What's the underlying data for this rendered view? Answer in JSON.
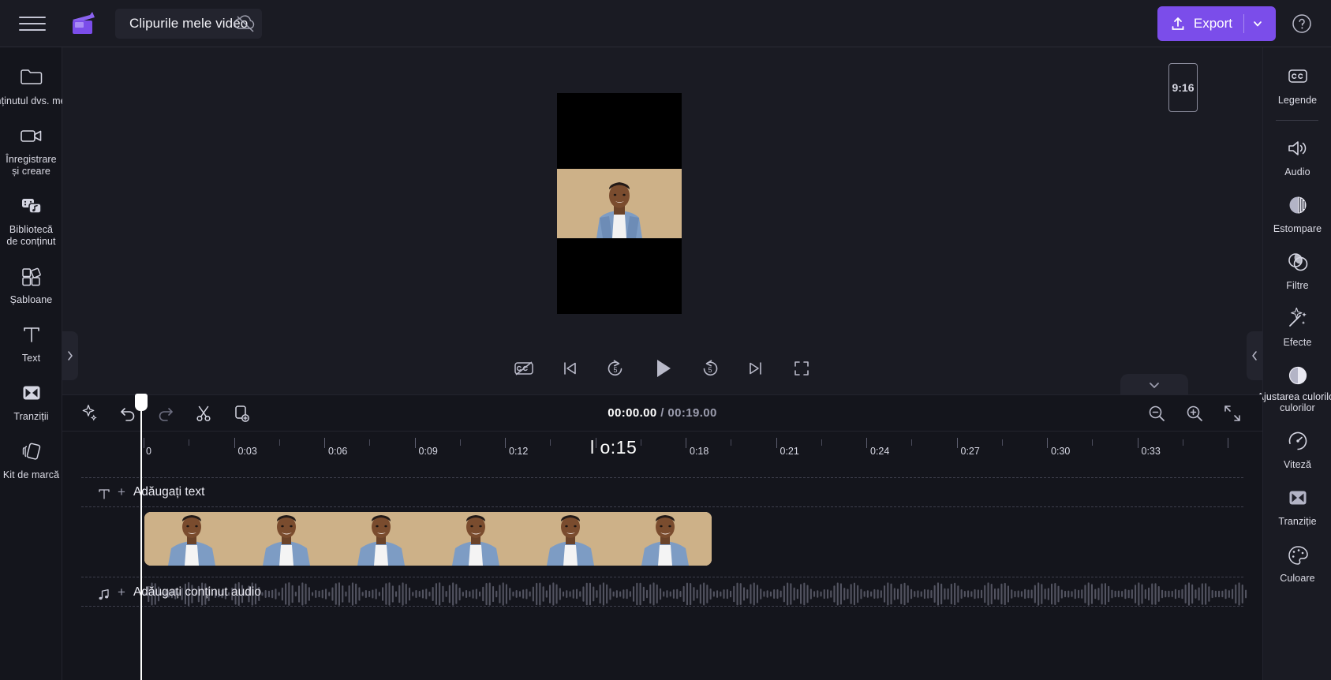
{
  "app": {
    "title": "Clipurile mele video",
    "menu_icon": "hamburger-icon",
    "logo_icon": "clipchamp-logo",
    "cloud_icon": "cloud-offline-icon"
  },
  "topbar": {
    "export_label": "Export",
    "export_color": "#7b4dea",
    "export_icon": "upload-icon",
    "export_chevron": "chevron-down-icon",
    "help_icon": "help-circle-icon"
  },
  "left_rail": {
    "items": [
      {
        "label": "Conținutul dvs. media",
        "icon": "folder-icon",
        "wide": true
      },
      {
        "label": "Înregistrare\ncreare",
        "line1": "Înregistrare",
        "line2": "și creare",
        "icon": "camera-icon"
      },
      {
        "label": "Bibliotecă de conținut",
        "line1": "Bibliotecă",
        "line2": "de conținut",
        "icon": "content-library-icon"
      },
      {
        "label": "Șabloane",
        "line1": "Șabloane",
        "line2": "",
        "icon": "templates-icon"
      },
      {
        "label": "Text",
        "line1": "Text",
        "line2": "",
        "icon": "text-icon"
      },
      {
        "label": "Tranziții",
        "line1": "Tranziții",
        "line2": "",
        "icon": "transitions-icon"
      },
      {
        "label": "Kit de marcă",
        "line1": "Kit de marcă",
        "line2": "",
        "icon": "brand-kit-icon"
      }
    ]
  },
  "right_rail": {
    "items": [
      {
        "label": "Legende",
        "icon": "closed-captions-icon",
        "divider_after": true
      },
      {
        "label": "Audio",
        "icon": "speaker-icon"
      },
      {
        "label": "Estompare",
        "icon": "fade-icon"
      },
      {
        "label": "Filtre",
        "icon": "filters-icon"
      },
      {
        "label": "Efecte",
        "icon": "effects-wand-icon"
      },
      {
        "label": "culorilor",
        "tiny_label": "Ajustarea culorilor",
        "icon": "color-adjust-icon"
      },
      {
        "label": "Viteză",
        "icon": "speed-gauge-icon"
      },
      {
        "label": "Tranziție",
        "icon": "transition-icon"
      },
      {
        "label": "Culoare",
        "icon": "color-palette-icon"
      }
    ]
  },
  "preview": {
    "aspect_ratio": "9:16",
    "collapse_left_icon": "chevron-right-icon",
    "collapse_right_icon": "chevron-left-icon",
    "collapse_timeline_icon": "chevron-down-icon",
    "controls": [
      {
        "name": "captions-off-button",
        "icon": "captions-off-icon"
      },
      {
        "name": "jump-start-button",
        "icon": "skip-previous-icon"
      },
      {
        "name": "back-5-button",
        "icon": "rewind-5-icon"
      },
      {
        "name": "play-button",
        "icon": "play-icon"
      },
      {
        "name": "forward-5-button",
        "icon": "forward-5-icon"
      },
      {
        "name": "jump-end-button",
        "icon": "skip-next-icon"
      },
      {
        "name": "fullscreen-button",
        "icon": "fullscreen-icon"
      }
    ]
  },
  "timeline": {
    "tools": [
      {
        "name": "magic-tools-button",
        "icon": "sparkle-icon"
      },
      {
        "name": "undo-button",
        "icon": "undo-icon"
      },
      {
        "name": "redo-button",
        "icon": "redo-icon"
      },
      {
        "name": "split-button",
        "icon": "scissors-icon"
      },
      {
        "name": "duplicate-button",
        "icon": "duplicate-icon"
      }
    ],
    "current_time": "00:00.00",
    "separator": "/",
    "total_time": "00:19.00",
    "zoom_out_icon": "zoom-out-icon",
    "zoom_in_icon": "zoom-in-icon",
    "fit-icon": "fit-to-screen-icon",
    "ruler": {
      "zero_label": "0",
      "labels": [
        "0:03",
        "0:06",
        "0:09",
        "0:12",
        "0:18",
        "0:21",
        "0:24",
        "0:27",
        "0:30",
        "0:33"
      ],
      "hover_label": "l o:15"
    },
    "tracks": {
      "text_track_label": "Adăugați text",
      "text_track_icon": "text-T-icon",
      "audio_track_label": "Adăugați conținut audio",
      "audio_track_icon": "music-note-icon",
      "plus": "+"
    },
    "clip": {
      "name": "video-clip",
      "frames": 6
    }
  },
  "colors": {
    "bg": "#14151c",
    "panel": "#1a1b23",
    "accent": "#7b4dea",
    "text": "#e8e8ee",
    "muted": "#9b9cad",
    "clip_bg": "#cdb188"
  }
}
